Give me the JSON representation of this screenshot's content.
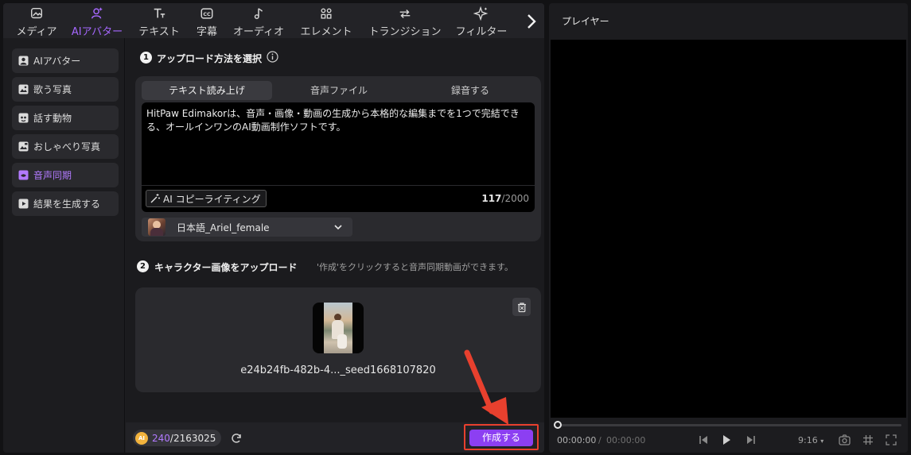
{
  "topnav": {
    "items": [
      {
        "label": "メディア",
        "icon": "media-icon"
      },
      {
        "label": "AIアバター",
        "icon": "ai-avatar-icon",
        "active": true
      },
      {
        "label": "テキスト",
        "icon": "text-icon"
      },
      {
        "label": "字幕",
        "icon": "caption-icon"
      },
      {
        "label": "オーディオ",
        "icon": "music-note-icon"
      },
      {
        "label": "エレメント",
        "icon": "element-icon"
      },
      {
        "label": "トランジション",
        "icon": "transition-icon"
      },
      {
        "label": "フィルター",
        "icon": "filter-icon"
      }
    ],
    "next_icon": "chevron-right-icon"
  },
  "sidebar": {
    "items": [
      {
        "label": "AIアバター",
        "icon": "person-icon"
      },
      {
        "label": "歌う写真",
        "icon": "photo-icon"
      },
      {
        "label": "話す動物",
        "icon": "animal-icon"
      },
      {
        "label": "おしゃべり写真",
        "icon": "photo-chat-icon"
      },
      {
        "label": "音声同期",
        "icon": "lip-sync-icon",
        "active": true
      },
      {
        "label": "結果を生成する",
        "icon": "video-result-icon"
      }
    ]
  },
  "step1": {
    "number": "1",
    "title": "アップロード方法を選択",
    "tabs": [
      "テキスト読み上げ",
      "音声ファイル",
      "録音する"
    ],
    "active_tab": 0,
    "script_text": "HitPaw Edimakorは、音声・画像・動画の生成から本格的な編集までを1つで完結できる、オールインワンのAI動画制作ソフトです。",
    "ai_copy_label": "AI コピーライティング",
    "char_count": "117",
    "char_limit": "/2000",
    "voice": "日本語_Ariel_female"
  },
  "step2": {
    "number": "2",
    "title": "キャラクター画像をアップロード",
    "hint": "'作成'をクリックすると音声同期動画ができます。",
    "filename": "e24b24fb-482b-4..._seed1668107820"
  },
  "footer": {
    "coin_label": "AI",
    "credits_used": "240",
    "credits_total": "/2163025",
    "create_label": "作成する"
  },
  "player": {
    "title": "プレイヤー",
    "time_current": "00:00:00",
    "time_separator": "/",
    "time_total": "00:00:00",
    "progress": 0,
    "aspect_ratio": "9:16"
  },
  "colors": {
    "accent": "#8c3ff2",
    "accent_text": "#a668ff",
    "highlight": "#e8402e"
  }
}
